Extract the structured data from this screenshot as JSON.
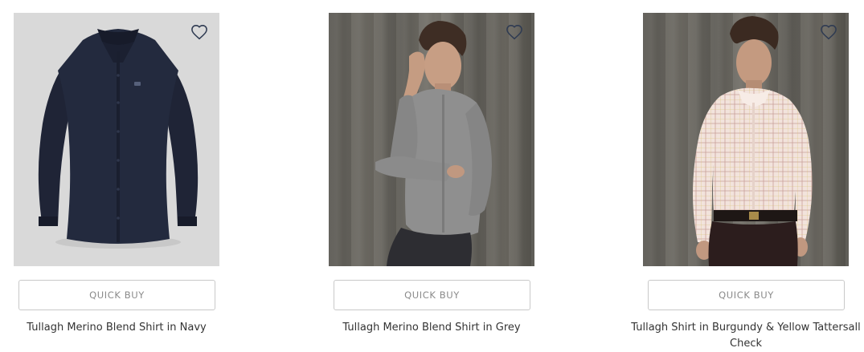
{
  "products": [
    {
      "title": "Tullagh Merino Blend Shirt in Navy",
      "quick_buy_label": "QUICK BUY",
      "wishlist_icon": "heart-icon",
      "image_subject": "navy-shirt-packshot",
      "image_background": "#d9d9d9",
      "shirt_color": "#1f2436"
    },
    {
      "title": "Tullagh Merino Blend Shirt in Grey",
      "quick_buy_label": "QUICK BUY",
      "wishlist_icon": "heart-icon",
      "image_subject": "model-grey-shirt",
      "image_background": "#67645d",
      "shirt_color": "#8f8f8f"
    },
    {
      "title": "Tullagh Shirt in Burgundy & Yellow Tattersall Check",
      "quick_buy_label": "QUICK BUY",
      "wishlist_icon": "heart-icon",
      "image_subject": "model-tattersall-shirt",
      "image_background": "#67645d",
      "shirt_color": "#f2e3dc"
    }
  ],
  "theme": {
    "text_color": "#333333",
    "button_border": "#c9c9c9",
    "button_text": "#8a8a8a",
    "icon_color": "#2f3b52"
  }
}
